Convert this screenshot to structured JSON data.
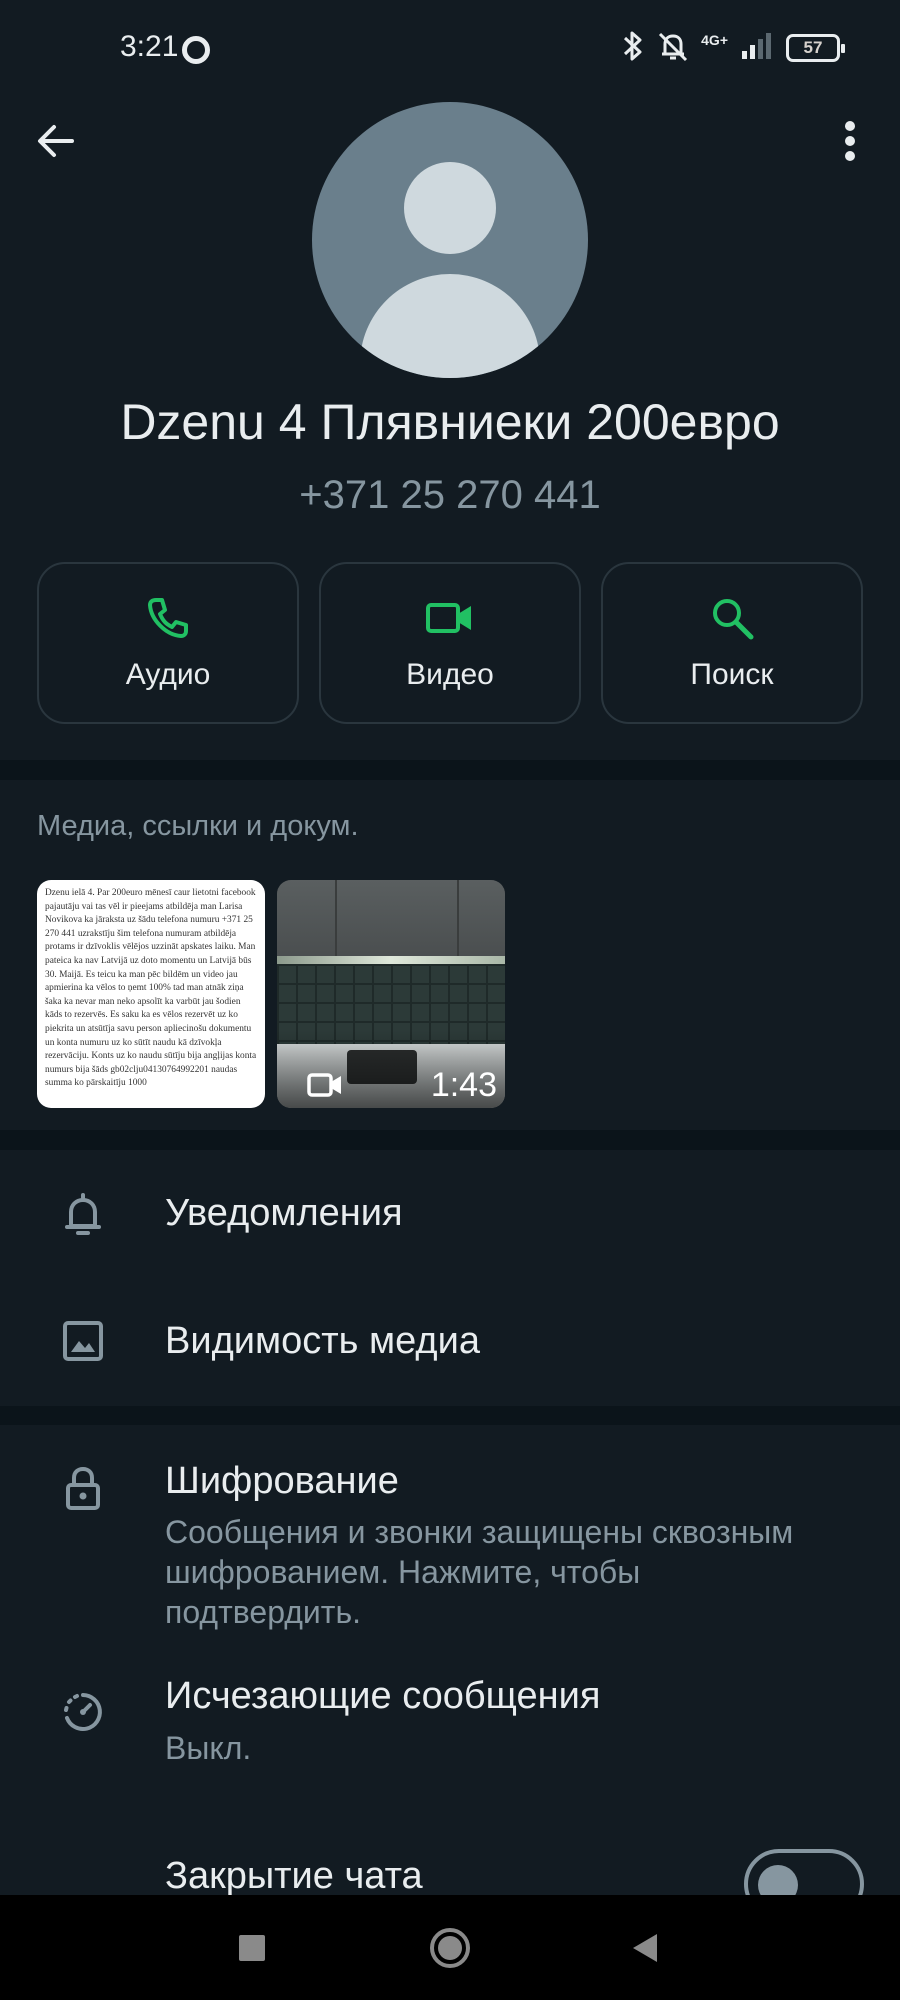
{
  "status_bar": {
    "time": "3:21",
    "network": "4G+",
    "battery": "57"
  },
  "contact": {
    "name": "Dzenu 4 Плявниеки 200евро",
    "phone": "+371 25 270 441"
  },
  "actions": [
    {
      "label": "Аудио",
      "icon": "phone-icon"
    },
    {
      "label": "Видео",
      "icon": "video-icon"
    },
    {
      "label": "Поиск",
      "icon": "search-icon"
    }
  ],
  "media": {
    "title": "Медиа, ссылки и докум.",
    "doc_preview": "Dzenu ielā 4. Par 200euro mēnesī caur lietotni facebook pajautāju vai tas vēl ir pieejams atbildēja man Larisa Novikova ka jāraksta uz šādu telefona numuru +371 25 270 441 uzrakstīju šim telefona numuram atbildēja protams ir dzīvoklis vēlējos uzzināt apskates laiku. Man pateica ka nav Latvijā uz doto momentu un Latvijā būs 30. Maijā. Es teicu ka man pēc bildēm un video jau apmierina ka vēlos to ņemt 100% tad man atnāk ziņa šaka ka nevar man neko apsolīt ka varbūt jau šodien kāds to rezervēs. Es saku ka es vēlos rezervēt uz ko piekrita un atsūtīja savu person apliecinošu dokumentu un konta numuru uz ko sūtīt naudu kā dzīvokļa rezervāciju. Konts uz ko naudu sūtīju bija angļijas konta numurs bija šāds gb02clju04130764992201 naudas summa ko pārskaitīju 1000",
    "video_duration": "1:43"
  },
  "settings": {
    "notifications": "Уведомления",
    "media_visibility": "Видимость медиа",
    "encryption": {
      "label": "Шифрование",
      "sub": "Сообщения и звонки защищены сквозным шифрованием. Нажмите, чтобы подтвердить."
    },
    "disappearing": {
      "label": "Исчезающие сообщения",
      "sub": "Выкл."
    },
    "chat_lock": {
      "label": "Закрытие чата",
      "enabled": false
    }
  },
  "colors": {
    "accent": "#21c063",
    "background": "#0b141a",
    "surface": "#121b22",
    "secondary_text": "#8696a0"
  }
}
